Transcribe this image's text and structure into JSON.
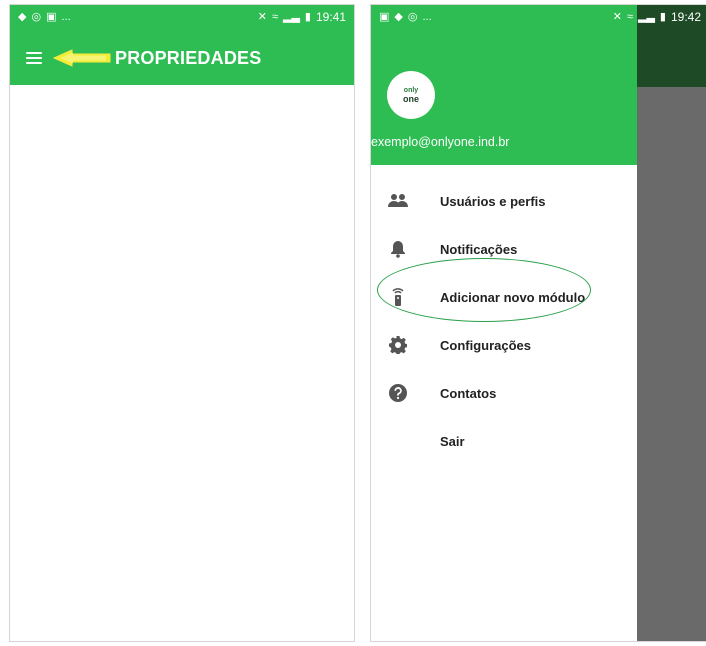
{
  "left_screen": {
    "status": {
      "time": "19:41",
      "left_icons": [
        "notification-icon",
        "whatsapp-icon",
        "image-icon"
      ],
      "more": "..."
    },
    "appbar": {
      "title": "PROPRIEDADES",
      "bg_color": "#2dbd53",
      "arrow_color": "#f2ef2a"
    }
  },
  "right_screen": {
    "status": {
      "time": "19:42",
      "left_icons": [
        "image-icon",
        "notification-icon",
        "whatsapp-icon"
      ],
      "more": "..."
    },
    "drawer": {
      "logo_text_top": "only",
      "logo_text_bottom": "one",
      "email": "exemplo@onlyone.ind.br",
      "items": [
        {
          "label": "Usuários e perfis",
          "icon": "users-icon"
        },
        {
          "label": "Notificações",
          "icon": "bell-icon"
        },
        {
          "label": "Adicionar novo módulo",
          "icon": "remote-icon",
          "highlighted": true
        },
        {
          "label": "Configurações",
          "icon": "gear-icon"
        },
        {
          "label": "Contatos",
          "icon": "help-icon"
        },
        {
          "label": "Sair",
          "icon": ""
        }
      ]
    }
  }
}
